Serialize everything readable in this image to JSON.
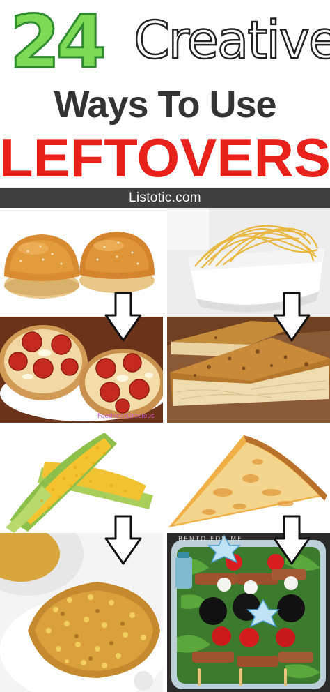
{
  "header": {
    "number": "24",
    "word_creative": "Creative",
    "line2": "Ways To Use",
    "line3": "LEFTOVERS",
    "site": "Listotic.com"
  },
  "colors": {
    "number_fill": "#7ed957",
    "number_stroke": "#2e8b2e",
    "leftovers_red": "#e8221a",
    "banner_bg": "#3f3f3f"
  },
  "watermarks": {
    "pizza_muffins": "FoodnessGracious",
    "bento": "BENTO FOR ME"
  },
  "tiles": [
    {
      "name": "hamburger-buns",
      "icon": "burger-bun-photo"
    },
    {
      "name": "spaghetti-bowl",
      "icon": "spaghetti-photo"
    },
    {
      "name": "pizza-muffins",
      "icon": "pepperoni-pizza-photo"
    },
    {
      "name": "spaghetti-frittata",
      "icon": "pasta-pie-photo"
    },
    {
      "name": "corn-on-cob",
      "icon": "corn-photo"
    },
    {
      "name": "pizza-slice",
      "icon": "pizza-slice-photo"
    },
    {
      "name": "corn-fritters",
      "icon": "corn-fritter-photo"
    },
    {
      "name": "pizza-kebabs",
      "icon": "bento-skewer-photo"
    }
  ]
}
